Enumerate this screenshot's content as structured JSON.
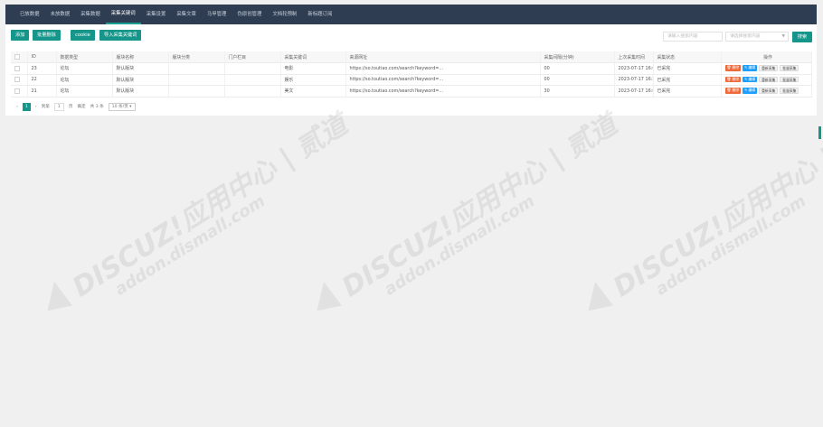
{
  "nav": {
    "tabs": [
      {
        "label": "已放数据",
        "active": false
      },
      {
        "label": "未放数据",
        "active": false
      },
      {
        "label": "采集数据",
        "active": false
      },
      {
        "label": "采集关键词",
        "active": true
      },
      {
        "label": "采集设置",
        "active": false
      },
      {
        "label": "采集文章",
        "active": false
      },
      {
        "label": "马甲管理",
        "active": false
      },
      {
        "label": "伪原创管理",
        "active": false
      },
      {
        "label": "文档轮预制",
        "active": false
      },
      {
        "label": "新标题订阅",
        "active": false
      }
    ]
  },
  "toolbar": {
    "add_label": "添加",
    "batch_delete_label": "批量删除",
    "cookie_label": "cookie",
    "import_label": "导入采集关键词",
    "keyword_placeholder": "请输入搜索内容",
    "keyword_select_value": "请选择搜索内容",
    "search_label": "搜索"
  },
  "table": {
    "columns": [
      "ID",
      "数据类型",
      "版块名称",
      "版块分类",
      "门户栏目",
      "采集关键词",
      "来源网址",
      "采集间隔(分钟)",
      "上次采集时间",
      "采集状态",
      "操作"
    ],
    "rows": [
      {
        "id": "23",
        "type": "论坛",
        "forum": "默认版块",
        "category": "",
        "portal": "",
        "keyword": "电影",
        "url": "https://so.toutiao.com/search?keyword=...",
        "interval": "00",
        "last_time": "2023-07-17 16:01:41",
        "status": "已采完"
      },
      {
        "id": "22",
        "type": "论坛",
        "forum": "默认版块",
        "category": "",
        "portal": "",
        "keyword": "娱乐",
        "url": "https://so.toutiao.com/search?keyword=...",
        "interval": "00",
        "last_time": "2023-07-17 16:27:05",
        "status": "已采完"
      },
      {
        "id": "21",
        "type": "论坛",
        "forum": "默认版块",
        "category": "",
        "portal": "",
        "keyword": "美文",
        "url": "https://so.toutiao.com/search?keyword=...",
        "interval": "30",
        "last_time": "2023-07-17 16:02:16",
        "status": "已采完"
      }
    ],
    "ops": {
      "delete": "删除",
      "edit": "编辑",
      "recollect": "重新采集",
      "view": "批量采集"
    }
  },
  "pager": {
    "current_page": "1",
    "goto_text": "到第",
    "page_input": "1",
    "page_unit": "页",
    "confirm_label": "确定",
    "total_text": "共 3 条",
    "page_size": "10 条/页"
  },
  "watermark": {
    "main": "DISCUZ!应用中心 | 贰道",
    "sub": "addon.dismall.com"
  }
}
